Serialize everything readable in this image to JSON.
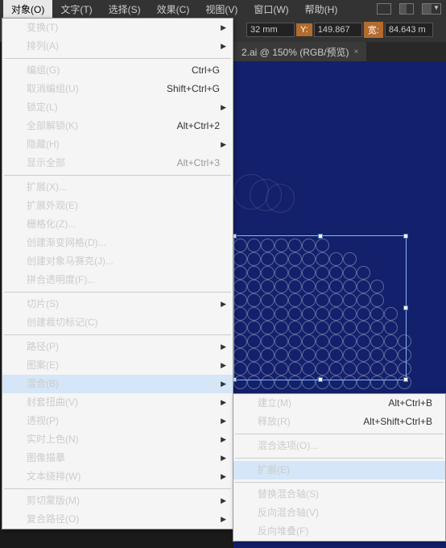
{
  "menubar": {
    "items": [
      {
        "label": "对象(O)",
        "active": true
      },
      {
        "label": "文字(T)"
      },
      {
        "label": "选择(S)"
      },
      {
        "label": "效果(C)"
      },
      {
        "label": "视图(V)"
      },
      {
        "label": "窗口(W)"
      },
      {
        "label": "帮助(H)"
      }
    ]
  },
  "toolbar": {
    "x_value": "32 mm",
    "y_label": "Y:",
    "y_value": "149.867 ",
    "w_label": "宽:",
    "w_value": "84.643 m"
  },
  "tab": {
    "label": "2.ai @ 150% (RGB/预览)",
    "close": "×"
  },
  "dropdown": [
    {
      "label": "变换(T)",
      "arrow": true
    },
    {
      "label": "排列(A)",
      "arrow": true
    },
    {
      "sep": true
    },
    {
      "label": "编组(G)",
      "shortcut": "Ctrl+G"
    },
    {
      "label": "取消编组(U)",
      "shortcut": "Shift+Ctrl+G"
    },
    {
      "label": "锁定(L)",
      "arrow": true
    },
    {
      "label": "全部解锁(K)",
      "shortcut": "Alt+Ctrl+2"
    },
    {
      "label": "隐藏(H)",
      "arrow": true
    },
    {
      "label": "显示全部",
      "shortcut": "Alt+Ctrl+3",
      "disabled": true
    },
    {
      "sep": true
    },
    {
      "label": "扩展(X)..."
    },
    {
      "label": "扩展外观(E)",
      "disabled": true
    },
    {
      "label": "栅格化(Z)..."
    },
    {
      "label": "创建渐变网格(D)..."
    },
    {
      "label": "创建对象马赛克(J)..."
    },
    {
      "label": "拼合透明度(F)..."
    },
    {
      "sep": true
    },
    {
      "label": "切片(S)",
      "arrow": true
    },
    {
      "label": "创建裁切标记(C)"
    },
    {
      "sep": true
    },
    {
      "label": "路径(P)",
      "arrow": true
    },
    {
      "label": "图案(E)",
      "arrow": true
    },
    {
      "label": "混合(B)",
      "arrow": true,
      "highlighted": true
    },
    {
      "label": "封套扭曲(V)",
      "arrow": true
    },
    {
      "label": "透视(P)",
      "arrow": true
    },
    {
      "label": "实时上色(N)",
      "arrow": true
    },
    {
      "label": "图像描摹",
      "arrow": true
    },
    {
      "label": "文本绕排(W)",
      "arrow": true
    },
    {
      "sep": true
    },
    {
      "label": "剪切蒙版(M)",
      "arrow": true
    },
    {
      "label": "复合路径(O)",
      "arrow": true
    }
  ],
  "submenu": [
    {
      "label": "建立(M)",
      "shortcut": "Alt+Ctrl+B"
    },
    {
      "label": "释放(R)",
      "shortcut": "Alt+Shift+Ctrl+B"
    },
    {
      "sep": true
    },
    {
      "label": "混合选项(O)..."
    },
    {
      "sep": true
    },
    {
      "label": "扩展(E)",
      "highlighted": true
    },
    {
      "sep": true
    },
    {
      "label": "替换混合轴(S)",
      "disabled": true
    },
    {
      "label": "反向混合轴(V)"
    },
    {
      "label": "反向堆叠(F)"
    }
  ]
}
